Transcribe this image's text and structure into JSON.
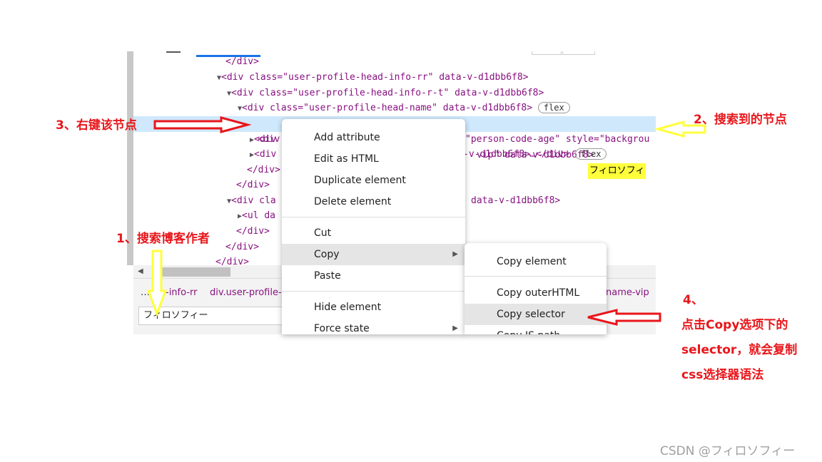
{
  "devtools": {
    "lines": [
      "</div>",
      "<div class=\"user-profile-head-info-rr\" data-v-d1dbb6f8>",
      "<div class=\"user-profile-head-info-r-t\" data-v-d1dbb6f8>",
      "<div class=\"user-profile-head-name\" data-v-d1dbb6f8>",
      "flex",
      "<div",
      "vip\" data-v-d1dbb6f8>",
      "フィロソフィ",
      "<div",
      "\"person-code-age\" style=\"backgrou",
      "<div",
      "-v-d1dbb6f8>…</div>",
      "</div>",
      "</div>",
      "<div cla",
      "data-v-d1dbb6f8>",
      "<ul da",
      "</div>",
      "</div>",
      "</div>"
    ],
    "breadcrumbs": [
      "…",
      "-info-rr",
      "div.user-profile-",
      "name-vip"
    ],
    "search_value": "フィロソフィー"
  },
  "context_menu": {
    "items": [
      "Add attribute",
      "Edit as HTML",
      "Duplicate element",
      "Delete element",
      "Cut",
      "Copy",
      "Paste",
      "Hide element",
      "Force state"
    ],
    "active_item": "Copy"
  },
  "submenu": {
    "items": [
      "Copy element",
      "Copy outerHTML",
      "Copy selector",
      "Copy JS path"
    ],
    "active_item": "Copy selector"
  },
  "annotations": {
    "step1": "1、搜索博客作者",
    "step2": "2、搜索到的节点",
    "step3": "3、右键该节点",
    "step4_num": "4、",
    "step4_line1": "点击Copy选项下的",
    "step4_line2": "selector，就会复制",
    "step4_line3": "css选择器语法"
  },
  "watermark": "CSDN @フィロソフィー",
  "colors": {
    "annotation": "#e8161b",
    "highlight": "#ffff3c",
    "selected_row": "#cfe8fc"
  }
}
